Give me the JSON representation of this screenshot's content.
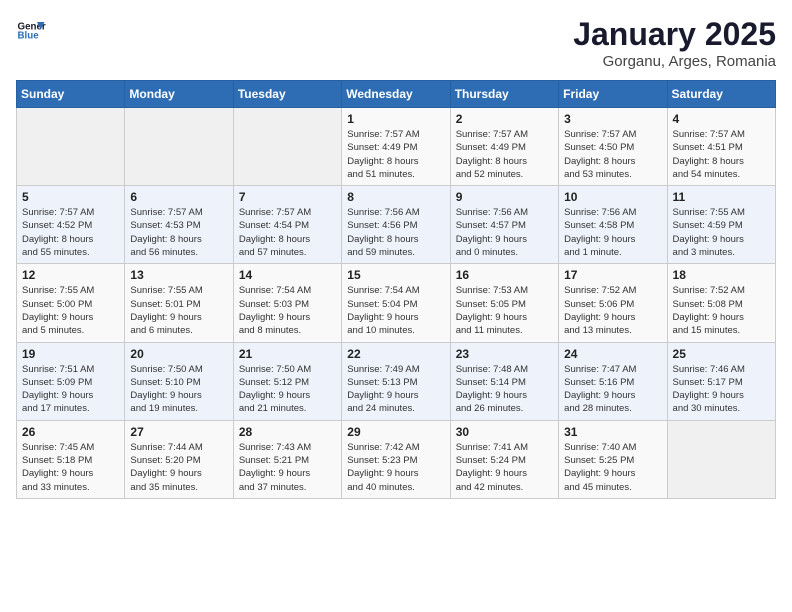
{
  "logo": {
    "line1": "General",
    "line2": "Blue"
  },
  "title": "January 2025",
  "subtitle": "Gorganu, Arges, Romania",
  "days_header": [
    "Sunday",
    "Monday",
    "Tuesday",
    "Wednesday",
    "Thursday",
    "Friday",
    "Saturday"
  ],
  "weeks": [
    [
      {
        "day": "",
        "info": ""
      },
      {
        "day": "",
        "info": ""
      },
      {
        "day": "",
        "info": ""
      },
      {
        "day": "1",
        "info": "Sunrise: 7:57 AM\nSunset: 4:49 PM\nDaylight: 8 hours\nand 51 minutes."
      },
      {
        "day": "2",
        "info": "Sunrise: 7:57 AM\nSunset: 4:49 PM\nDaylight: 8 hours\nand 52 minutes."
      },
      {
        "day": "3",
        "info": "Sunrise: 7:57 AM\nSunset: 4:50 PM\nDaylight: 8 hours\nand 53 minutes."
      },
      {
        "day": "4",
        "info": "Sunrise: 7:57 AM\nSunset: 4:51 PM\nDaylight: 8 hours\nand 54 minutes."
      }
    ],
    [
      {
        "day": "5",
        "info": "Sunrise: 7:57 AM\nSunset: 4:52 PM\nDaylight: 8 hours\nand 55 minutes."
      },
      {
        "day": "6",
        "info": "Sunrise: 7:57 AM\nSunset: 4:53 PM\nDaylight: 8 hours\nand 56 minutes."
      },
      {
        "day": "7",
        "info": "Sunrise: 7:57 AM\nSunset: 4:54 PM\nDaylight: 8 hours\nand 57 minutes."
      },
      {
        "day": "8",
        "info": "Sunrise: 7:56 AM\nSunset: 4:56 PM\nDaylight: 8 hours\nand 59 minutes."
      },
      {
        "day": "9",
        "info": "Sunrise: 7:56 AM\nSunset: 4:57 PM\nDaylight: 9 hours\nand 0 minutes."
      },
      {
        "day": "10",
        "info": "Sunrise: 7:56 AM\nSunset: 4:58 PM\nDaylight: 9 hours\nand 1 minute."
      },
      {
        "day": "11",
        "info": "Sunrise: 7:55 AM\nSunset: 4:59 PM\nDaylight: 9 hours\nand 3 minutes."
      }
    ],
    [
      {
        "day": "12",
        "info": "Sunrise: 7:55 AM\nSunset: 5:00 PM\nDaylight: 9 hours\nand 5 minutes."
      },
      {
        "day": "13",
        "info": "Sunrise: 7:55 AM\nSunset: 5:01 PM\nDaylight: 9 hours\nand 6 minutes."
      },
      {
        "day": "14",
        "info": "Sunrise: 7:54 AM\nSunset: 5:03 PM\nDaylight: 9 hours\nand 8 minutes."
      },
      {
        "day": "15",
        "info": "Sunrise: 7:54 AM\nSunset: 5:04 PM\nDaylight: 9 hours\nand 10 minutes."
      },
      {
        "day": "16",
        "info": "Sunrise: 7:53 AM\nSunset: 5:05 PM\nDaylight: 9 hours\nand 11 minutes."
      },
      {
        "day": "17",
        "info": "Sunrise: 7:52 AM\nSunset: 5:06 PM\nDaylight: 9 hours\nand 13 minutes."
      },
      {
        "day": "18",
        "info": "Sunrise: 7:52 AM\nSunset: 5:08 PM\nDaylight: 9 hours\nand 15 minutes."
      }
    ],
    [
      {
        "day": "19",
        "info": "Sunrise: 7:51 AM\nSunset: 5:09 PM\nDaylight: 9 hours\nand 17 minutes."
      },
      {
        "day": "20",
        "info": "Sunrise: 7:50 AM\nSunset: 5:10 PM\nDaylight: 9 hours\nand 19 minutes."
      },
      {
        "day": "21",
        "info": "Sunrise: 7:50 AM\nSunset: 5:12 PM\nDaylight: 9 hours\nand 21 minutes."
      },
      {
        "day": "22",
        "info": "Sunrise: 7:49 AM\nSunset: 5:13 PM\nDaylight: 9 hours\nand 24 minutes."
      },
      {
        "day": "23",
        "info": "Sunrise: 7:48 AM\nSunset: 5:14 PM\nDaylight: 9 hours\nand 26 minutes."
      },
      {
        "day": "24",
        "info": "Sunrise: 7:47 AM\nSunset: 5:16 PM\nDaylight: 9 hours\nand 28 minutes."
      },
      {
        "day": "25",
        "info": "Sunrise: 7:46 AM\nSunset: 5:17 PM\nDaylight: 9 hours\nand 30 minutes."
      }
    ],
    [
      {
        "day": "26",
        "info": "Sunrise: 7:45 AM\nSunset: 5:18 PM\nDaylight: 9 hours\nand 33 minutes."
      },
      {
        "day": "27",
        "info": "Sunrise: 7:44 AM\nSunset: 5:20 PM\nDaylight: 9 hours\nand 35 minutes."
      },
      {
        "day": "28",
        "info": "Sunrise: 7:43 AM\nSunset: 5:21 PM\nDaylight: 9 hours\nand 37 minutes."
      },
      {
        "day": "29",
        "info": "Sunrise: 7:42 AM\nSunset: 5:23 PM\nDaylight: 9 hours\nand 40 minutes."
      },
      {
        "day": "30",
        "info": "Sunrise: 7:41 AM\nSunset: 5:24 PM\nDaylight: 9 hours\nand 42 minutes."
      },
      {
        "day": "31",
        "info": "Sunrise: 7:40 AM\nSunset: 5:25 PM\nDaylight: 9 hours\nand 45 minutes."
      },
      {
        "day": "",
        "info": ""
      }
    ]
  ]
}
